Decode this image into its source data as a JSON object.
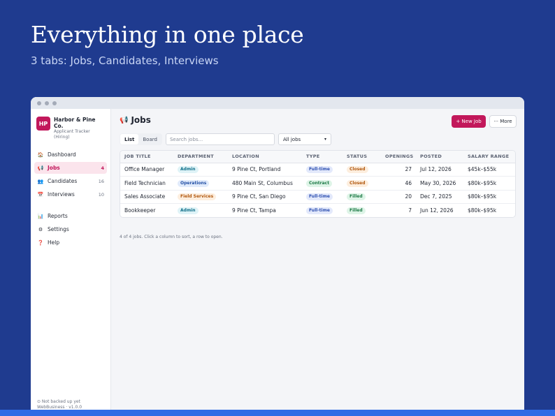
{
  "hero": {
    "title": "Everything in one place",
    "subtitle": "3 tabs: Jobs, Candidates, Interviews"
  },
  "brand": {
    "initials": "HP",
    "name": "Harbor & Pine Co.",
    "tagline": "Applicant Tracker (Hiring)",
    "color": "#c2185b"
  },
  "sidebar": {
    "items": [
      {
        "label": "Dashboard",
        "icon": "home-icon",
        "glyph": "🏠",
        "count": ""
      },
      {
        "label": "Jobs",
        "icon": "megaphone-icon",
        "glyph": "📢",
        "count": "4"
      },
      {
        "label": "Candidates",
        "icon": "people-icon",
        "glyph": "👥",
        "count": "16"
      },
      {
        "label": "Interviews",
        "icon": "calendar-icon",
        "glyph": "📅",
        "count": "10"
      }
    ],
    "secondary": [
      {
        "label": "Reports",
        "icon": "chart-icon",
        "glyph": "📊"
      },
      {
        "label": "Settings",
        "icon": "gear-icon",
        "glyph": "⚙"
      },
      {
        "label": "Help",
        "icon": "help-icon",
        "glyph": "❓"
      }
    ],
    "footer_line1": "⊙ Not backed up yet",
    "footer_line2": "WebBusiness · v1.0.0"
  },
  "main": {
    "title": "Jobs",
    "new_button": "+ New Job",
    "more_button": "··· More",
    "view_tabs": [
      "List",
      "Board"
    ],
    "search_placeholder": "Search jobs...",
    "filter_value": "All jobs",
    "footnote": "4 of 4 jobs. Click a column to sort, a row to open."
  },
  "table": {
    "headers": [
      "JOB TITLE",
      "DEPARTMENT",
      "LOCATION",
      "TYPE",
      "STATUS",
      "OPENINGS",
      "POSTED",
      "SALARY RANGE"
    ],
    "rows": [
      {
        "title": "Office Manager",
        "department": "Admin",
        "location": "9 Pine Ct, Portland",
        "type": "Full-time",
        "status": "Closed",
        "openings": "27",
        "posted": "Jul 12, 2026",
        "salary": "$45k–$55k"
      },
      {
        "title": "Field Technician",
        "department": "Operations",
        "location": "480 Main St, Columbus",
        "type": "Contract",
        "status": "Closed",
        "openings": "46",
        "posted": "May 30, 2026",
        "salary": "$80k–$95k"
      },
      {
        "title": "Sales Associate",
        "department": "Field Services",
        "location": "9 Pine Ct, San Diego",
        "type": "Full-time",
        "status": "Filled",
        "openings": "20",
        "posted": "Dec 7, 2025",
        "salary": "$80k–$95k"
      },
      {
        "title": "Bookkeeper",
        "department": "Admin",
        "location": "9 Pine Ct, Tampa",
        "type": "Full-time",
        "status": "Filled",
        "openings": "7",
        "posted": "Jun 12, 2026",
        "salary": "$80k–$95k"
      }
    ]
  },
  "pill_colors": {
    "Admin": {
      "bg": "#dff3f7",
      "fg": "#11708a"
    },
    "Operations": {
      "bg": "#e1ebfb",
      "fg": "#2451a6"
    },
    "Field Services": {
      "bg": "#fdeede",
      "fg": "#b25a12"
    },
    "Full-time": {
      "bg": "#e3e9fb",
      "fg": "#2d4fb0"
    },
    "Contract": {
      "bg": "#def4e7",
      "fg": "#1d7a46"
    },
    "Closed": {
      "bg": "#fdeede",
      "fg": "#b25a12"
    },
    "Filled": {
      "bg": "#def4e7",
      "fg": "#1d7a46"
    }
  }
}
